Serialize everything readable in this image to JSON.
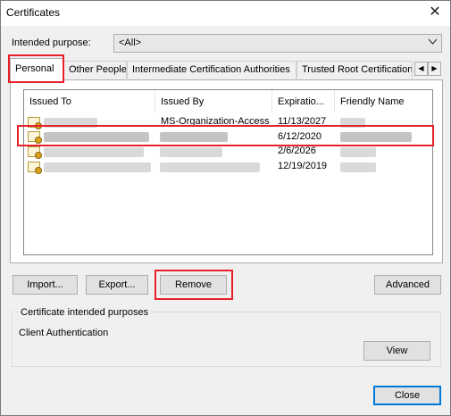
{
  "window": {
    "title": "Certificates",
    "close_glyph": "✕"
  },
  "intended_purpose": {
    "label": "Intended purpose:",
    "value": "<All>"
  },
  "tabs": [
    {
      "label": "Personal",
      "active": true
    },
    {
      "label": "Other People",
      "active": false
    },
    {
      "label": "Intermediate Certification Authorities",
      "active": false
    },
    {
      "label": "Trusted Root Certification Authorities",
      "active": false
    }
  ],
  "columns": [
    "Issued To",
    "Issued By",
    "Expiratio...",
    "Friendly Name"
  ],
  "rows": [
    {
      "issued_by": "MS-Organization-Access",
      "expiration": "11/13/2027",
      "selected": false
    },
    {
      "issued_by": "",
      "expiration": "6/12/2020",
      "selected": true
    },
    {
      "issued_by": "",
      "expiration": "2/6/2026",
      "selected": false
    },
    {
      "issued_by": "",
      "expiration": "12/19/2019",
      "selected": false
    }
  ],
  "buttons": {
    "import": "Import...",
    "export": "Export...",
    "remove": "Remove",
    "advanced": "Advanced",
    "view": "View",
    "close": "Close"
  },
  "purposes": {
    "group_label": "Certificate intended purposes",
    "value": "Client Authentication"
  },
  "colors": {
    "highlight": "#e8202a",
    "icon": "#d9a21b"
  },
  "icons": {
    "tab_scroll_left": "◀",
    "tab_scroll_right": "▶",
    "dropdown": "chevron-down-icon"
  }
}
